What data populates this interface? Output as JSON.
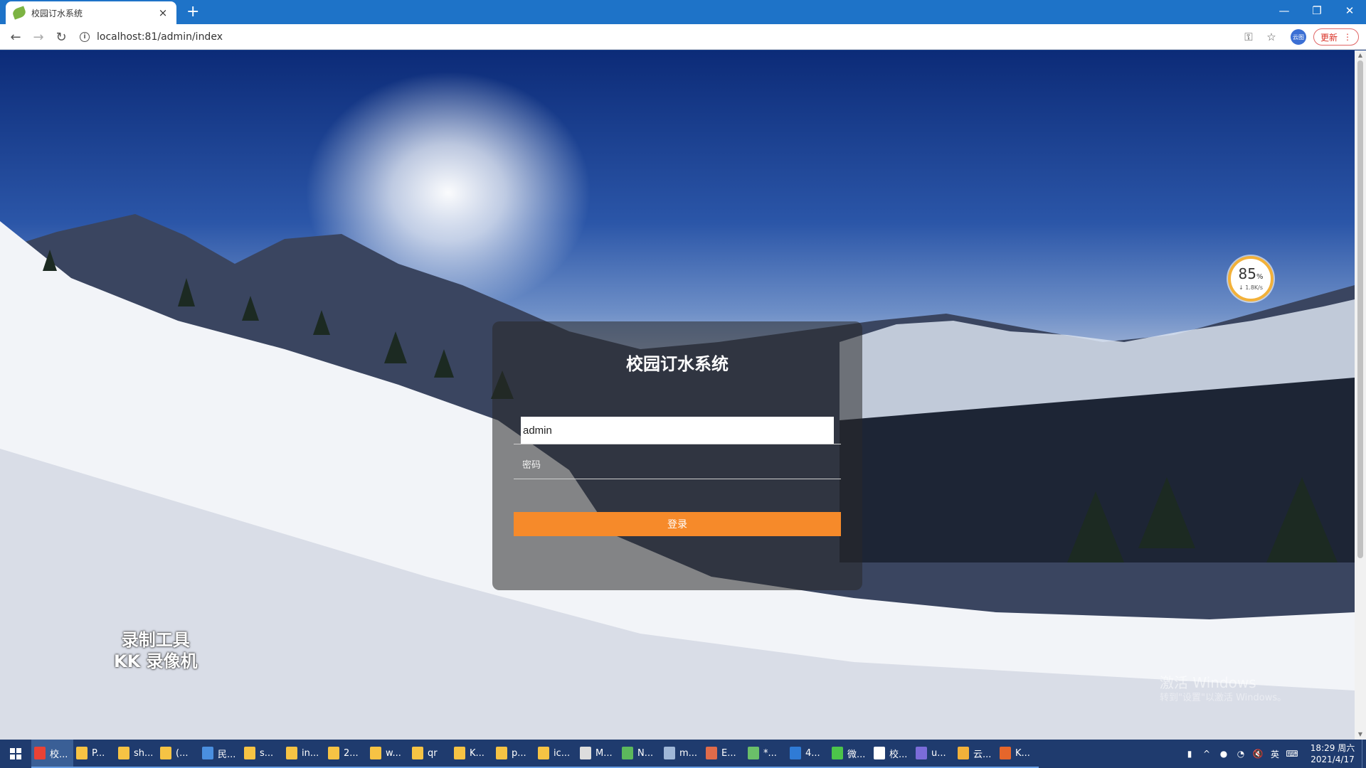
{
  "browser": {
    "tab_title": "校园订水系统",
    "tab_close": "×",
    "new_tab": "+",
    "url": "localhost:81/admin/index",
    "profile_label": "云图",
    "update_label": "更新",
    "window_controls": {
      "minimize": "—",
      "restore": "❐",
      "close": "✕"
    }
  },
  "login": {
    "title": "校园订水系统",
    "username_value": "admin",
    "password_placeholder": "密码",
    "submit_label": "登录"
  },
  "overlays": {
    "speed_percent": "85",
    "speed_unit": "%",
    "speed_rate": "↓ 1.8K/s",
    "watermark_line1": "录制工具",
    "watermark_line2": "KK 录像机",
    "activate_title": "激活 Windows",
    "activate_sub": "转到\"设置\"以激活 Windows。"
  },
  "taskbar": {
    "items": [
      {
        "label": "校...",
        "color": "#e94235"
      },
      {
        "label": "P...",
        "color": "#f6c344"
      },
      {
        "label": "sh...",
        "color": "#f6c344"
      },
      {
        "label": "(...",
        "color": "#f6c344"
      },
      {
        "label": "民...",
        "color": "#4a8fe0"
      },
      {
        "label": "s...",
        "color": "#f6c344"
      },
      {
        "label": "in...",
        "color": "#f6c344"
      },
      {
        "label": "2...",
        "color": "#f6c344"
      },
      {
        "label": "w...",
        "color": "#f6c344"
      },
      {
        "label": "qr",
        "color": "#f6c344"
      },
      {
        "label": "K...",
        "color": "#f6c344"
      },
      {
        "label": "p...",
        "color": "#f6c344"
      },
      {
        "label": "ic...",
        "color": "#f6c344"
      },
      {
        "label": "M...",
        "color": "#dddddd"
      },
      {
        "label": "N...",
        "color": "#5cb85c"
      },
      {
        "label": "m...",
        "color": "#9fb7d8"
      },
      {
        "label": "E...",
        "color": "#e06b4a"
      },
      {
        "label": "*...",
        "color": "#6abf69"
      },
      {
        "label": "4...",
        "color": "#2f7bd6"
      },
      {
        "label": "微...",
        "color": "#4cc44a"
      },
      {
        "label": "校...",
        "color": "#ffffff"
      },
      {
        "label": "u...",
        "color": "#7b6cd9"
      },
      {
        "label": "云...",
        "color": "#f2b13a"
      },
      {
        "label": "K...",
        "color": "#e6662b"
      }
    ],
    "tray_lang": "英",
    "time": "18:29 周六",
    "date": "2021/4/17"
  }
}
